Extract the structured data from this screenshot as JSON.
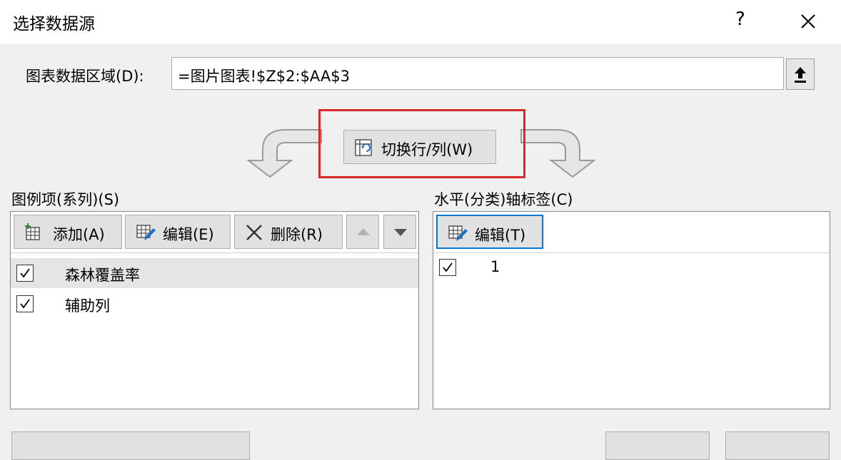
{
  "dialog": {
    "title": "选择数据源",
    "help_label": "?"
  },
  "data_range": {
    "label": "图表数据区域(D):",
    "value": "=图片图表!$Z$2:$AA$3"
  },
  "switch": {
    "label": "切换行/列(W)"
  },
  "legend": {
    "section_label": "图例项(系列)(S)",
    "add_label": "添加(A)",
    "edit_label": "编辑(E)",
    "delete_label": "删除(R)",
    "items": [
      {
        "label": "森林覆盖率",
        "checked": true,
        "selected": true
      },
      {
        "label": "辅助列",
        "checked": true,
        "selected": false
      }
    ]
  },
  "axis": {
    "section_label": "水平(分类)轴标签(C)",
    "edit_label": "编辑(T)",
    "items": [
      {
        "label": "1",
        "checked": true
      }
    ]
  },
  "colors": {
    "highlight": "#d62a2a",
    "focus": "#0078d7"
  }
}
